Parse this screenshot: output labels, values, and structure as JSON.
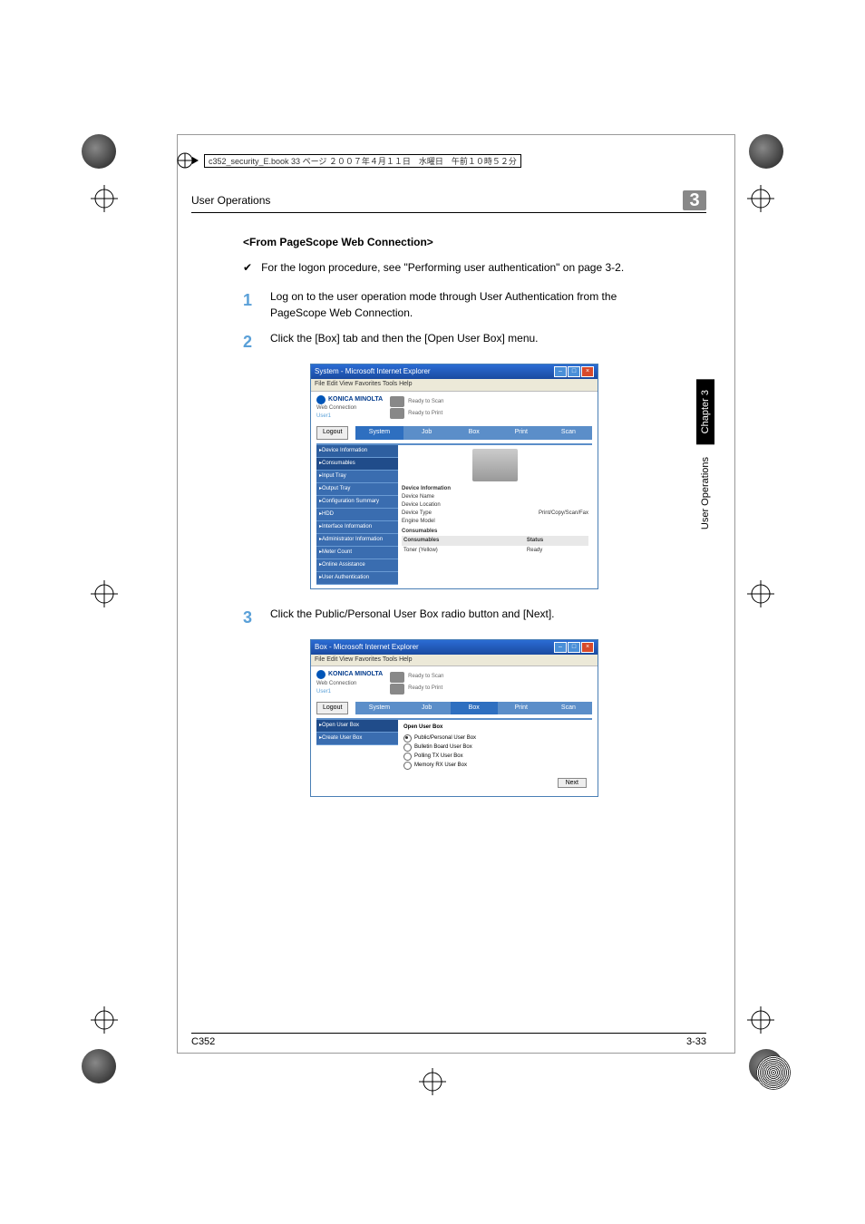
{
  "page_header_file": "c352_security_E.book  33 ページ  ２００７年４月１１日　水曜日　午前１０時５２分",
  "section_title": "User Operations",
  "chapter_number": "3",
  "heading": "<From PageScope Web Connection>",
  "checkmark": "✔",
  "check_text": "For the logon procedure, see \"Performing user authentication\" on page 3-2.",
  "step1_num": "1",
  "step1_text": "Log on to the user operation mode through User Authentication from the PageScope Web Connection.",
  "step2_num": "2",
  "step2_text": "Click the [Box] tab and then the [Open User Box] menu.",
  "step3_num": "3",
  "step3_text": "Click the Public/Personal User Box radio button and [Next].",
  "side_tab_chapter": "Chapter 3",
  "side_tab_label": "User Operations",
  "footer_left": "C352",
  "footer_right": "3-33",
  "ss1": {
    "title": "System - Microsoft Internet Explorer",
    "menus": "File   Edit   View   Favorites   Tools   Help",
    "brand": "KONICA MINOLTA",
    "brand_sub": "Web Connection",
    "status_scan": "Ready to Scan",
    "status_print": "Ready to Print",
    "user_label": "User1",
    "logout": "Logout",
    "tabs": {
      "t1": "System",
      "t2": "Job",
      "t3": "Box",
      "t4": "Print",
      "t5": "Scan"
    },
    "side": {
      "s1": "▸Device Information",
      "s2": "▸Consumables",
      "s3": "▸Input Tray",
      "s4": "▸Output Tray",
      "s5": "▸Configuration Summary",
      "s6": "▸HDD",
      "s7": "▸Interface Information",
      "s8": "▸Administrator Information",
      "s9": "▸Meter Count",
      "s10": "▸Online Assistance",
      "s11": "▸User Authentication"
    },
    "pane": {
      "h1": "Device Information",
      "r1": "Device Name",
      "r2": "Device Location",
      "r3": "Device Type",
      "r3v": "Print/Copy/Scan/Fax",
      "r4": "Engine Model",
      "h2": "Consumables",
      "th1": "Consumables",
      "th2": "Status",
      "c1": "Toner (Yellow)",
      "c1v": "Ready"
    }
  },
  "ss2": {
    "title": "Box - Microsoft Internet Explorer",
    "menus": "File   Edit   View   Favorites   Tools   Help",
    "brand": "KONICA MINOLTA",
    "brand_sub": "Web Connection",
    "status_scan": "Ready to Scan",
    "status_print": "Ready to Print",
    "user_label": "User1",
    "logout": "Logout",
    "tabs": {
      "t1": "System",
      "t2": "Job",
      "t3": "Box",
      "t4": "Print",
      "t5": "Scan"
    },
    "side": {
      "s1": "▸Open User Box",
      "s2": "▸Create User Box"
    },
    "pane": {
      "hdr": "Open User Box",
      "o1": "Public/Personal User Box",
      "o2": "Bulletin Board User Box",
      "o3": "Polling TX User Box",
      "o4": "Memory RX User Box",
      "next": "Next"
    }
  }
}
